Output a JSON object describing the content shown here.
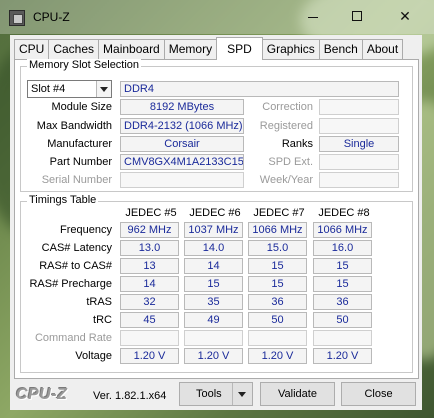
{
  "window": {
    "title": "CPU-Z"
  },
  "tabs": [
    {
      "label": "CPU"
    },
    {
      "label": "Caches"
    },
    {
      "label": "Mainboard"
    },
    {
      "label": "Memory"
    },
    {
      "label": "SPD",
      "active": true
    },
    {
      "label": "Graphics"
    },
    {
      "label": "Bench"
    },
    {
      "label": "About"
    }
  ],
  "memory_slot": {
    "group_title": "Memory Slot Selection",
    "slot_selected": "Slot #4",
    "type": "DDR4",
    "module_size_label": "Module Size",
    "module_size": "8192 MBytes",
    "max_bandwidth_label": "Max Bandwidth",
    "max_bandwidth": "DDR4-2132 (1066 MHz)",
    "manufacturer_label": "Manufacturer",
    "manufacturer": "Corsair",
    "part_number_label": "Part Number",
    "part_number": "CMV8GX4M1A2133C15",
    "serial_number_label": "Serial Number",
    "serial_number": "",
    "correction_label": "Correction",
    "correction": "",
    "registered_label": "Registered",
    "registered": "",
    "ranks_label": "Ranks",
    "ranks": "Single",
    "spd_ext_label": "SPD Ext.",
    "spd_ext": "",
    "week_year_label": "Week/Year",
    "week_year": ""
  },
  "timings": {
    "group_title": "Timings Table",
    "columns": [
      "JEDEC #5",
      "JEDEC #6",
      "JEDEC #7",
      "JEDEC #8"
    ],
    "rows": [
      {
        "label": "Frequency",
        "values": [
          "962 MHz",
          "1037 MHz",
          "1066 MHz",
          "1066 MHz"
        ]
      },
      {
        "label": "CAS# Latency",
        "values": [
          "13.0",
          "14.0",
          "15.0",
          "16.0"
        ]
      },
      {
        "label": "RAS# to CAS#",
        "values": [
          "13",
          "14",
          "15",
          "15"
        ]
      },
      {
        "label": "RAS# Precharge",
        "values": [
          "14",
          "15",
          "15",
          "15"
        ]
      },
      {
        "label": "tRAS",
        "values": [
          "32",
          "35",
          "36",
          "36"
        ]
      },
      {
        "label": "tRC",
        "values": [
          "45",
          "49",
          "50",
          "50"
        ]
      },
      {
        "label": "Command Rate",
        "values": [
          "",
          "",
          "",
          ""
        ],
        "dim": true
      },
      {
        "label": "Voltage",
        "values": [
          "1.20 V",
          "1.20 V",
          "1.20 V",
          "1.20 V"
        ]
      }
    ]
  },
  "footer": {
    "brand": "CPU-Z",
    "version": "Ver. 1.82.1.x64",
    "tools_label": "Tools",
    "validate_label": "Validate",
    "close_label": "Close"
  },
  "colors": {
    "value_text": "#1a2a9a",
    "panel_bg": "#efefef"
  }
}
